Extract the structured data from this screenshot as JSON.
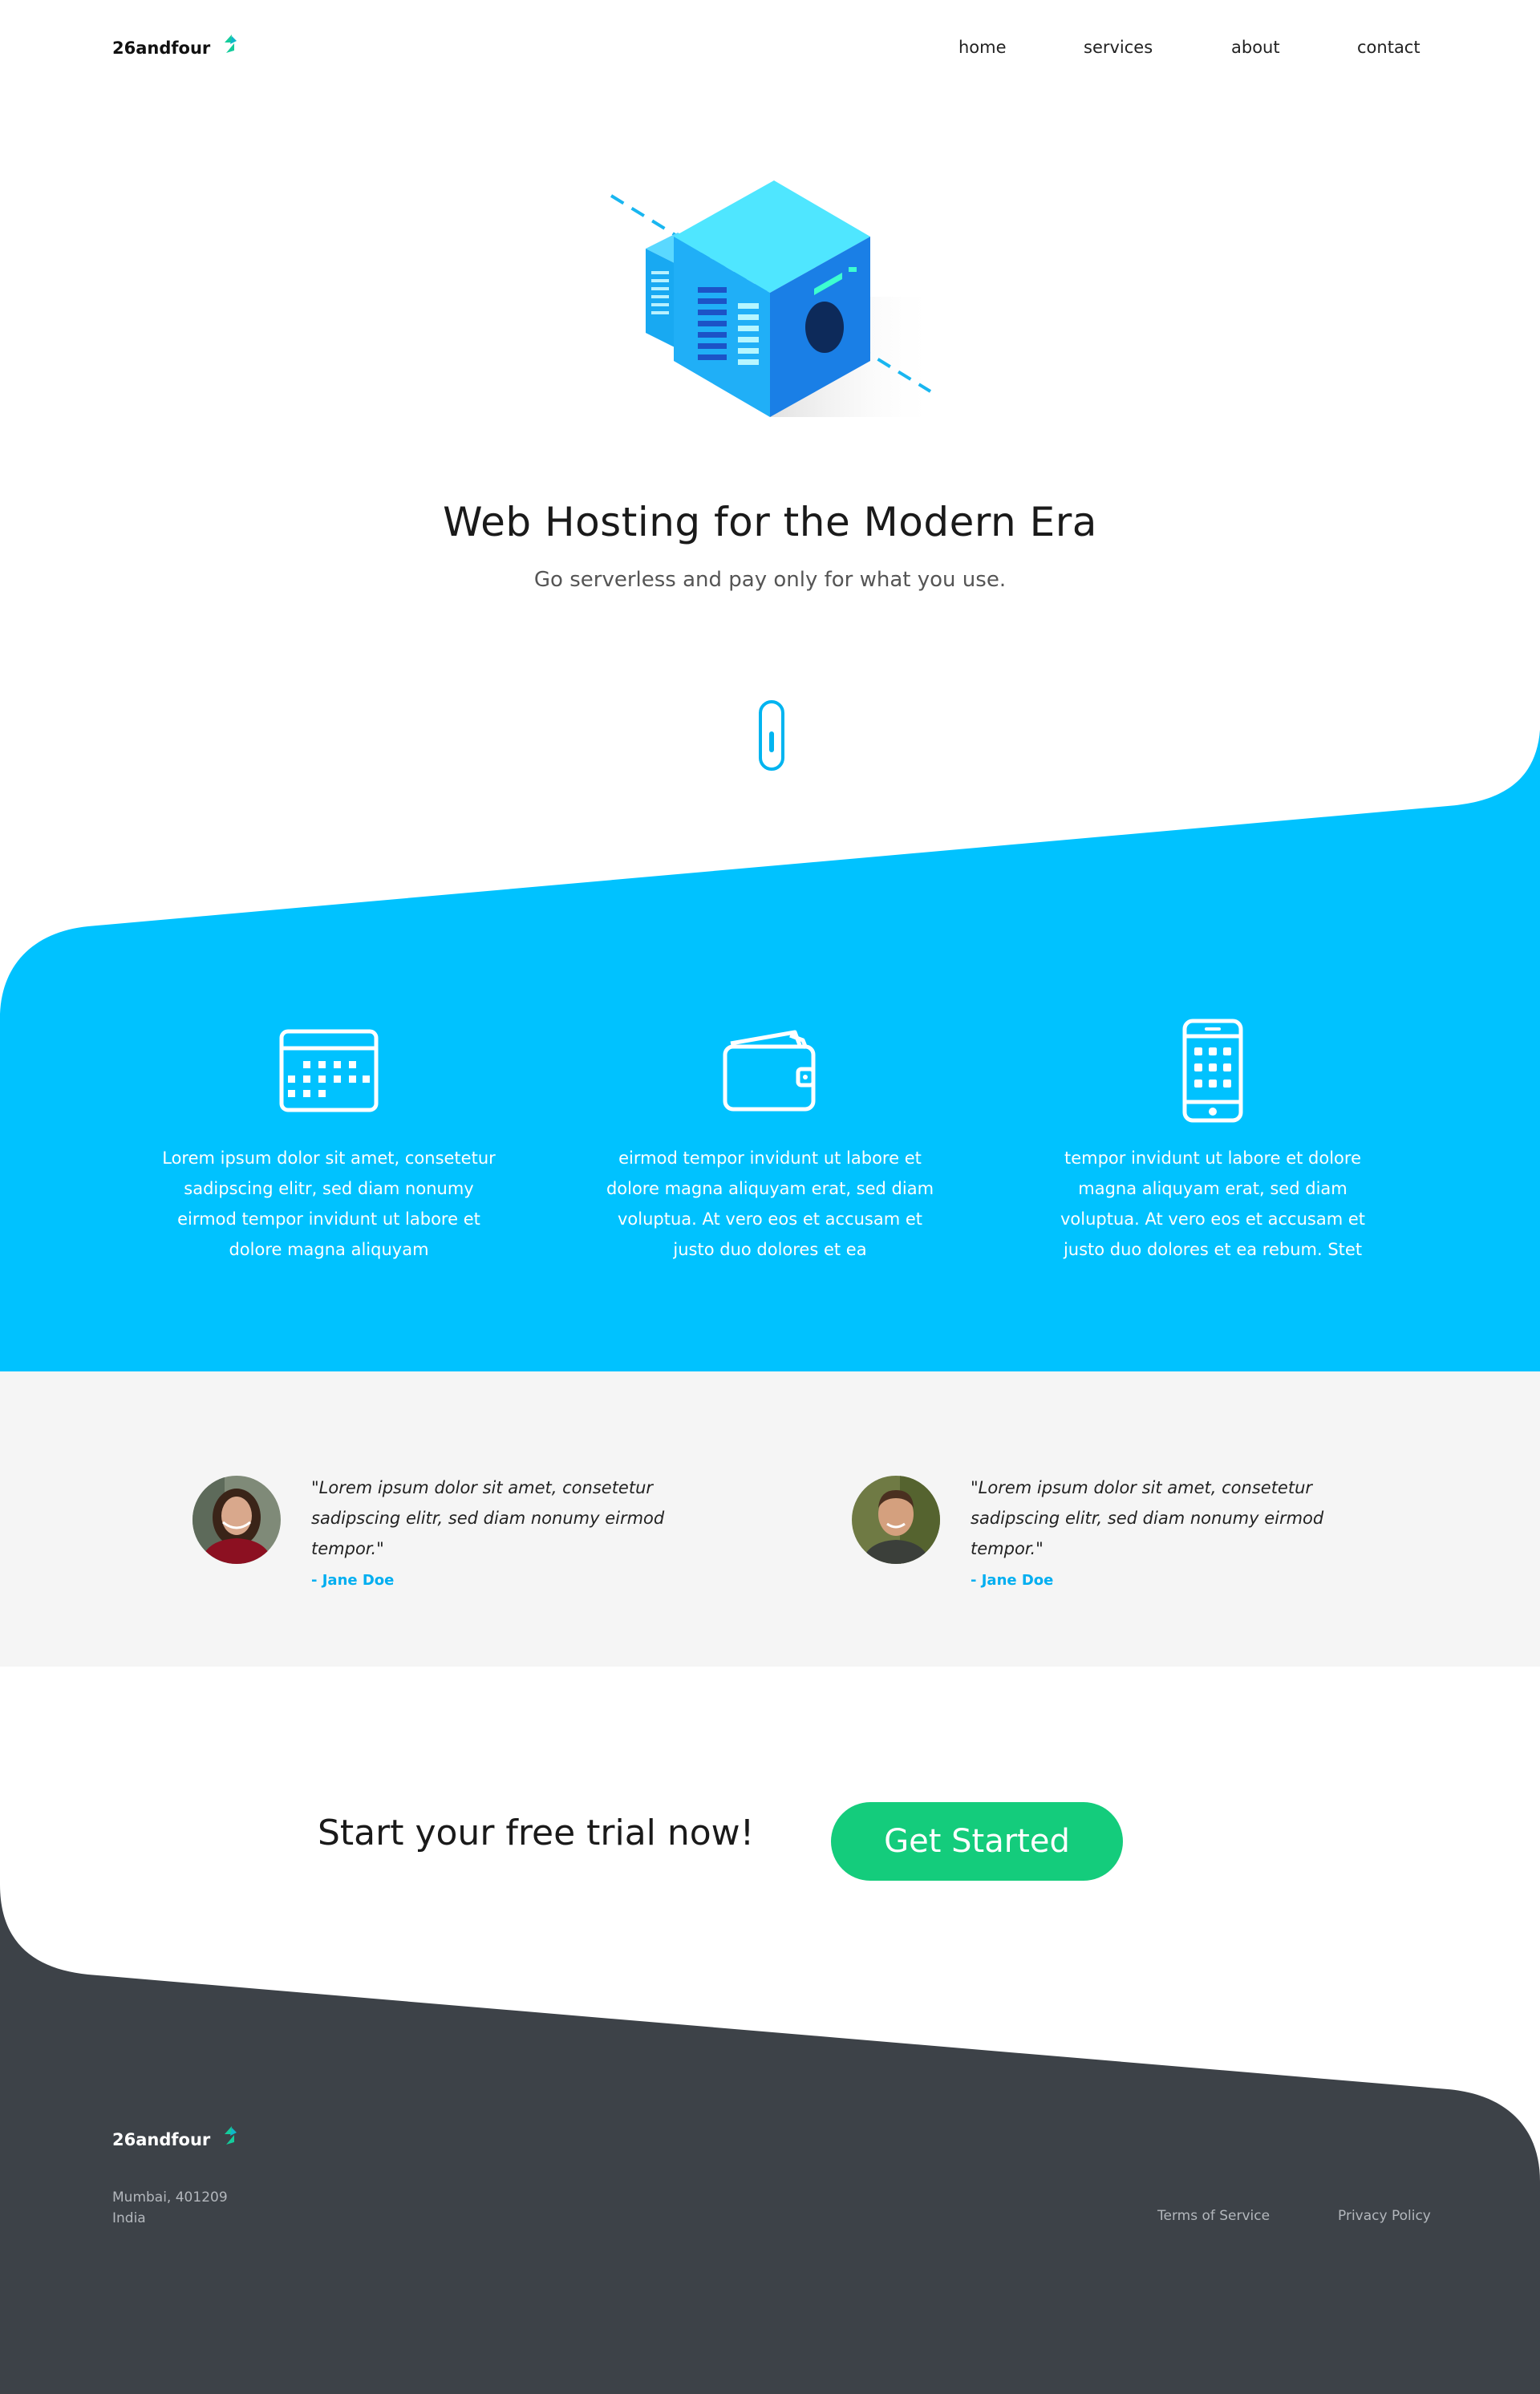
{
  "brand": {
    "name": "26andfour",
    "accent": "#00c2ff",
    "logo_mark_color": "#14cc9c"
  },
  "nav": {
    "home": "home",
    "services": "services",
    "about": "about",
    "contact": "contact"
  },
  "hero": {
    "title": "Web Hosting for the Modern Era",
    "subtitle": "Go serverless and pay only for what you use.",
    "illustration_icon": "server-cube-icon",
    "scroll_icon": "scroll-indicator-icon"
  },
  "features": [
    {
      "icon": "calendar-icon",
      "text": "Lorem ipsum dolor sit amet, consetetur sadipscing elitr, sed diam nonumy eirmod tempor invidunt ut labore et dolore magna aliquyam"
    },
    {
      "icon": "wallet-icon",
      "text": "eirmod tempor invidunt ut labore et dolore magna aliquyam erat, sed diam voluptua. At vero eos et accusam et justo duo dolores et ea"
    },
    {
      "icon": "smartphone-icon",
      "text": "tempor invidunt ut labore et dolore magna aliquyam erat, sed diam voluptua. At vero eos et accusam et justo duo dolores et ea rebum. Stet"
    }
  ],
  "testimonials": [
    {
      "quote": "\"Lorem ipsum dolor sit amet, consetetur sadipscing elitr, sed diam nonumy eirmod tempor.\"",
      "author": "- Jane Doe"
    },
    {
      "quote": "\"Lorem ipsum dolor sit amet, consetetur sadipscing elitr, sed diam nonumy eirmod tempor.\"",
      "author": "- Jane Doe"
    }
  ],
  "cta": {
    "text": "Start your free trial now!",
    "button": "Get Started",
    "button_color": "#14cc7c"
  },
  "footer": {
    "brand": "26andfour",
    "address_line1": "Mumbai, 401209",
    "address_line2": "India",
    "terms": "Terms of Service",
    "privacy": "Privacy Policy",
    "background": "#3d4248"
  }
}
